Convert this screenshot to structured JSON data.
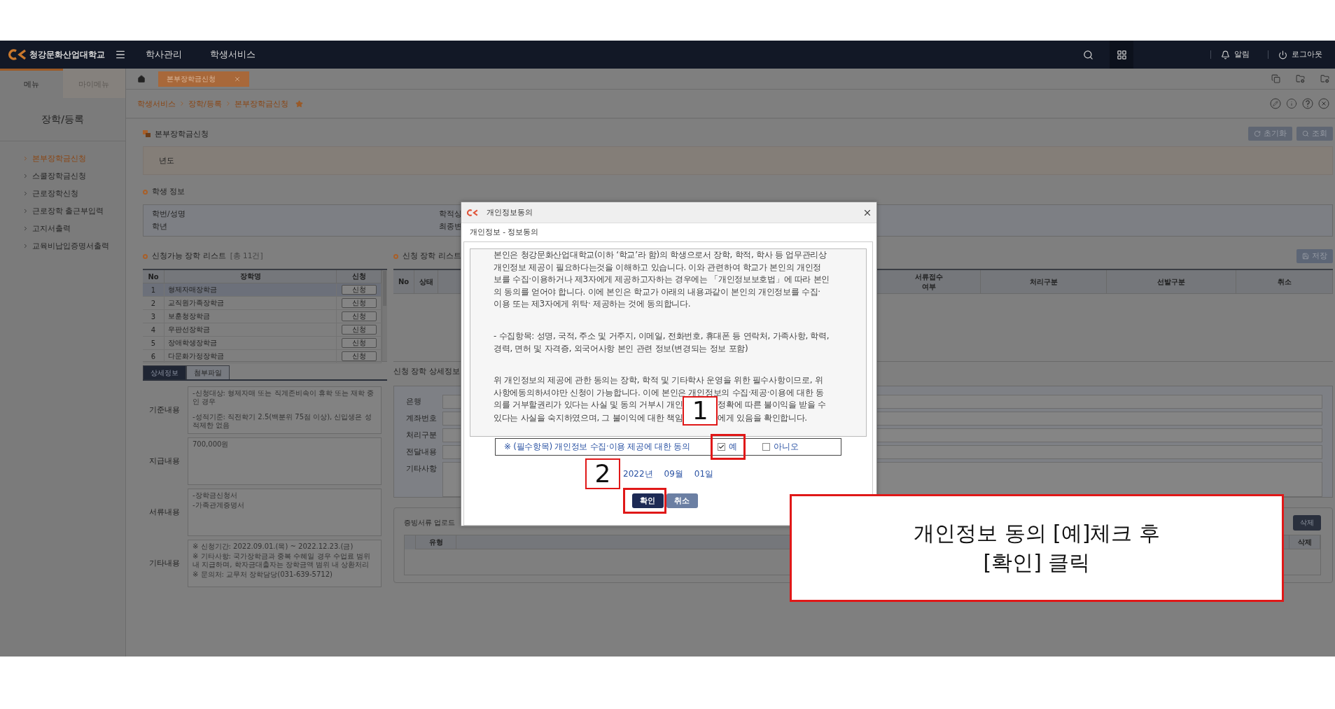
{
  "nav": {
    "logo_text": "청강문화산업대학교",
    "menus": [
      "학사관리",
      "학생서비스"
    ],
    "actions": [
      {
        "kind": "alert",
        "label": "알림"
      },
      {
        "kind": "logout",
        "label": "로그아웃"
      }
    ]
  },
  "sidebar": {
    "tabs": [
      {
        "label": "메뉴",
        "selected": true
      },
      {
        "label": "마이메뉴",
        "selected": false
      }
    ],
    "title": "장학/등록",
    "items": [
      {
        "label": "본부장학금신청",
        "selected": true
      },
      {
        "label": "스쿨장학금신청",
        "selected": false
      },
      {
        "label": "근로장학신청",
        "selected": false
      },
      {
        "label": "근로장학 출근부입력",
        "selected": false
      },
      {
        "label": "고지서출력",
        "selected": false
      },
      {
        "label": "교육비납입증명서출력",
        "selected": false
      }
    ]
  },
  "tab_bar": {
    "tabs": [
      {
        "label": "본부장학금신청",
        "selected": true
      }
    ]
  },
  "breadcrumb": {
    "items": [
      "학생서비스",
      "장학/등록",
      "본부장학금신청"
    ],
    "favorite": true
  },
  "page": {
    "title": "본부장학금신청",
    "buttons": [
      {
        "kind": "reset",
        "label": "초기화"
      },
      {
        "kind": "search",
        "label": "조회"
      }
    ],
    "search": {
      "label": "년도"
    },
    "student_info": {
      "heading": "학생 정보",
      "rows": [
        [
          "학번/성명",
          "학적상"
        ],
        [
          "학년",
          "최종변"
        ]
      ]
    },
    "available": {
      "heading": "신청가능 장학 리스트",
      "count": "[총 11건]",
      "columns": [
        "No",
        "장학명",
        "신청"
      ],
      "rows": [
        {
          "no": "1",
          "name": "형제자매장학금",
          "action": "신청",
          "selected": true
        },
        {
          "no": "2",
          "name": "교직원가족장학금",
          "action": "신청",
          "selected": false
        },
        {
          "no": "3",
          "name": "보훈청장학금",
          "action": "신청",
          "selected": false
        },
        {
          "no": "4",
          "name": "우판선장학금",
          "action": "신청",
          "selected": false
        },
        {
          "no": "5",
          "name": "장애학생장학금",
          "action": "신청",
          "selected": false
        },
        {
          "no": "6",
          "name": "다문화가정장학금",
          "action": "신청",
          "selected": false
        }
      ]
    },
    "detail_tabs": [
      {
        "label": "상세정보",
        "selected": true
      },
      {
        "label": "첨부파일",
        "selected": false
      }
    ],
    "details": [
      {
        "label": "기준내용",
        "text": [
          "-신청대상: 형제자매 또는 직계존비속이 휴학 또는 재학 중인 경우",
          "-성적기준: 직전학기 2.5(백분위 75점 이상), 신입생은 성적제한 없음"
        ]
      },
      {
        "label": "지급내용",
        "text": [
          "700,000원"
        ]
      },
      {
        "label": "서류내용",
        "text": [
          "-장학금신청서",
          "-가족관계증명서"
        ]
      },
      {
        "label": "기타내용",
        "text": [
          "※ 신청기간: 2022.09.01.(목) ~ 2022.12.23.(금)",
          "※ 기타사항: 국가장학금과 중복 수혜일 경우 수업료 범위 내 지급하며, 학자금대출자는 장학금액 범위 내 상환처리",
          "※ 문의처: 교무처 장학담당(031-639-5712)"
        ]
      }
    ],
    "applied": {
      "heading": "신청 장학 리스트",
      "save": "저장",
      "columns_left": [
        "No",
        "상태"
      ],
      "columns_right": [
        "서류접수 여부",
        "처리구분",
        "선발구분",
        "취소"
      ]
    },
    "applied_detail": {
      "heading": "신청 장학 상세정보",
      "labels": [
        "은행",
        "계좌번호",
        "처리구분",
        "전달내용",
        "기타사항"
      ]
    },
    "upload": {
      "heading": "증빙서류 업로드",
      "delete": "삭제",
      "columns": [
        "유형",
        "삭제"
      ]
    }
  },
  "dialog": {
    "title": "개인정보동의",
    "subtitle": "개인정보 - 정보동의",
    "paragraphs": [
      [
        [
          "본인은 청강문화산업대학교(이하 ‘학교’라 함)의 학생으로서 장학, 학적, 학사 등 업무관리상"
        ],
        [
          "개인정보 제공이 필요하다는것을 이해하고 있습니다. 이와 관련하여 학교가 본인의 개인정"
        ],
        [
          "보를 수집·이용하거나 제3자에게 제공하고자하는 경우에는 「개인정보보호법」에 따라 본인"
        ],
        [
          "의 동의를 얻어야 합니다. 이에 본인은 학교가 아래의 내용과같이 본인의 개인정보를 수집·"
        ],
        [
          "이용 또는 제3자에게 위탁· 제공하는 것에 동의합니다."
        ]
      ],
      [
        [
          "- 수집항목: 성명, 국적, 주소 및 거주지, 이메일, 전화번호, 휴대폰 등 연락처, 가족사항, 학력,"
        ],
        [
          "경력, 면허 및 자격증, 외국어사항 본인 관련 정보(변경되는 정보 포함)"
        ]
      ],
      [
        [
          "위 개인정보의 제공에 관한 동의는 장학, 학적 및 기타학사 운영을 위한 필수사항이므로, 위"
        ],
        [
          "사항에동의하셔야만 신청이 가능합니다. 이에 본인은 개인정보의 수집·제공·이용에 대한 동"
        ],
        [
          "의를 거부할권리가 있다는 사실 및 동의 거부시 개인",
          "정확에 따른 불이익을 받을 수"
        ],
        [
          "있다는 사실을 숙지하였으며, 그 불이익에 대한 책임",
          "에게 있음을 확인합니다."
        ]
      ]
    ],
    "consent": {
      "text": "※ (필수항목) 개인정보 수집·이용 제공에 대한 동의",
      "options": [
        {
          "label": "예",
          "checked": true,
          "highlighted": true
        },
        {
          "label": "아니오",
          "checked": false,
          "highlighted": false
        }
      ]
    },
    "date": [
      "2022년",
      "09월",
      "01일"
    ],
    "buttons": [
      {
        "label": "확인",
        "kind": "primary",
        "highlighted": true
      },
      {
        "label": "취소",
        "kind": "secondary",
        "highlighted": false
      }
    ]
  },
  "annotation": {
    "markers": [
      "1",
      "2"
    ],
    "callout": [
      "개인정보 동의 [예]체크 후",
      "[확인] 클릭"
    ]
  }
}
